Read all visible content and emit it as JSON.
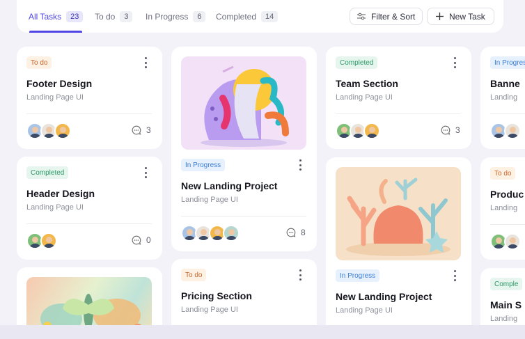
{
  "tabs": [
    {
      "label": "All Tasks",
      "count": "23"
    },
    {
      "label": "To do",
      "count": "3"
    },
    {
      "label": "In Progress",
      "count": "6"
    },
    {
      "label": "Completed",
      "count": "14"
    }
  ],
  "toolbar": {
    "filter_label": "Filter & Sort",
    "new_task_label": "New Task"
  },
  "cards": {
    "c1": {
      "status": "To do",
      "title": "Footer Design",
      "subtitle": "Landing Page UI",
      "comments": "3"
    },
    "c2": {
      "status": "Completed",
      "title": "Header Design",
      "subtitle": "Landing Page UI",
      "comments": "0"
    },
    "c4": {
      "status": "In Progress",
      "title": "New Landing Project",
      "subtitle": "Landing Page UI",
      "comments": "8"
    },
    "c5": {
      "status": "To do",
      "title": "Pricing Section",
      "subtitle": "Landing Page UI"
    },
    "c6": {
      "status": "Completed",
      "title": "Team Section",
      "subtitle": "Landing Page UI",
      "comments": "3"
    },
    "c7": {
      "status": "In Progress",
      "title": "New Landing Project",
      "subtitle": "Landing Page UI"
    },
    "c8": {
      "status": "In Progress",
      "title": "Banne",
      "subtitle": "Landing"
    },
    "c9": {
      "status": "To do",
      "title": "Produc",
      "subtitle": "Landing"
    },
    "c10": {
      "status": "Comple",
      "title": "Main S",
      "subtitle": "Landing"
    }
  },
  "colors": {
    "accent": "#4f46e5",
    "todo": "#c9662a",
    "completed": "#2e9968",
    "in_progress": "#3c7ed4"
  }
}
